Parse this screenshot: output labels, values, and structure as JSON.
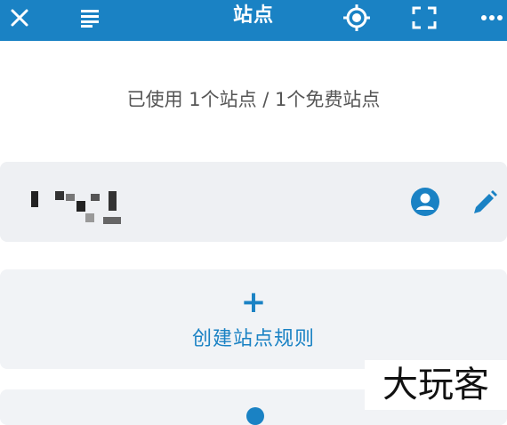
{
  "app": {
    "title": "站点",
    "accent": "#1a82c4"
  },
  "toolbar": {
    "icons": [
      "close-icon",
      "list-icon",
      "locate-icon",
      "scan-icon",
      "more-icon"
    ]
  },
  "usage_text": "已使用 1个站点 / 1个免费站点",
  "site": {
    "name_masked": true,
    "icons": [
      "account-icon",
      "edit-icon"
    ]
  },
  "create": {
    "plus": "+",
    "label": "创建站点规则"
  },
  "watermark": "大玩客"
}
